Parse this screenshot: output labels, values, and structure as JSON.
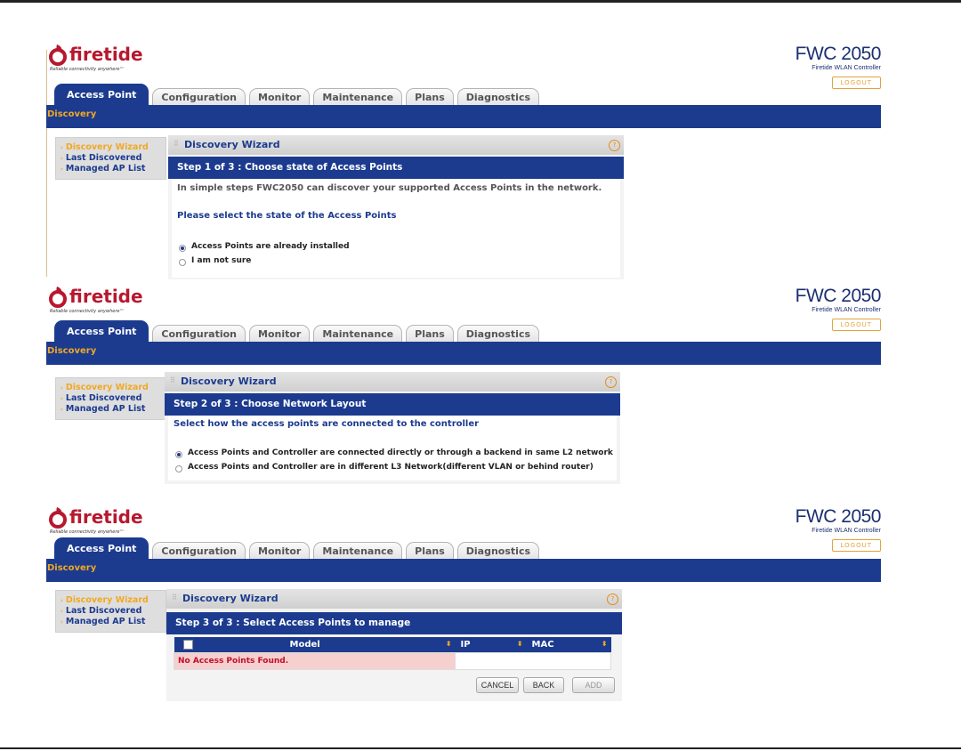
{
  "brand": {
    "logo_word": "firetide",
    "tagline": "Reliable connectivity anywhere™",
    "product": "FWC 2050",
    "product_sub": "Firetide WLAN Controller",
    "logout": "LOGOUT"
  },
  "tabs": [
    "Access Point",
    "Configuration",
    "Monitor",
    "Maintenance",
    "Plans",
    "Diagnostics"
  ],
  "active_tab": "Access Point",
  "breadcrumb": "Discovery",
  "menu": [
    "Discovery Wizard",
    "Last Discovered",
    "Managed AP List"
  ],
  "active_menu": "Discovery Wizard",
  "wizard_title": "Discovery Wizard",
  "help_glyph": "?",
  "step1": {
    "title": "Step 1 of 3 : Choose state of Access Points",
    "intro": "In simple steps FWC2050 can discover your supported Access Points in the network.",
    "question": "Please select the state of the Access Points",
    "options": [
      "Access Points are already installed",
      "I am not sure"
    ],
    "selected": 0
  },
  "step2": {
    "title": "Step 2 of 3 : Choose Network Layout",
    "question": "Select how the access points are connected to the controller",
    "options": [
      "Access Points and Controller are connected directly or through a backend in same L2 network",
      "Access Points and Controller are in different L3 Network(different VLAN or behind router)"
    ],
    "selected": 0
  },
  "step3": {
    "title": "Step 3 of 3 : Select Access Points to manage",
    "columns": [
      "Model",
      "IP",
      "MAC"
    ],
    "empty_message": "No Access Points Found.",
    "buttons": {
      "cancel": "CANCEL",
      "back": "BACK",
      "add": "ADD"
    }
  },
  "colors": {
    "navy": "#1c3b8f",
    "orange": "#f0a824",
    "red": "#b7182e"
  }
}
